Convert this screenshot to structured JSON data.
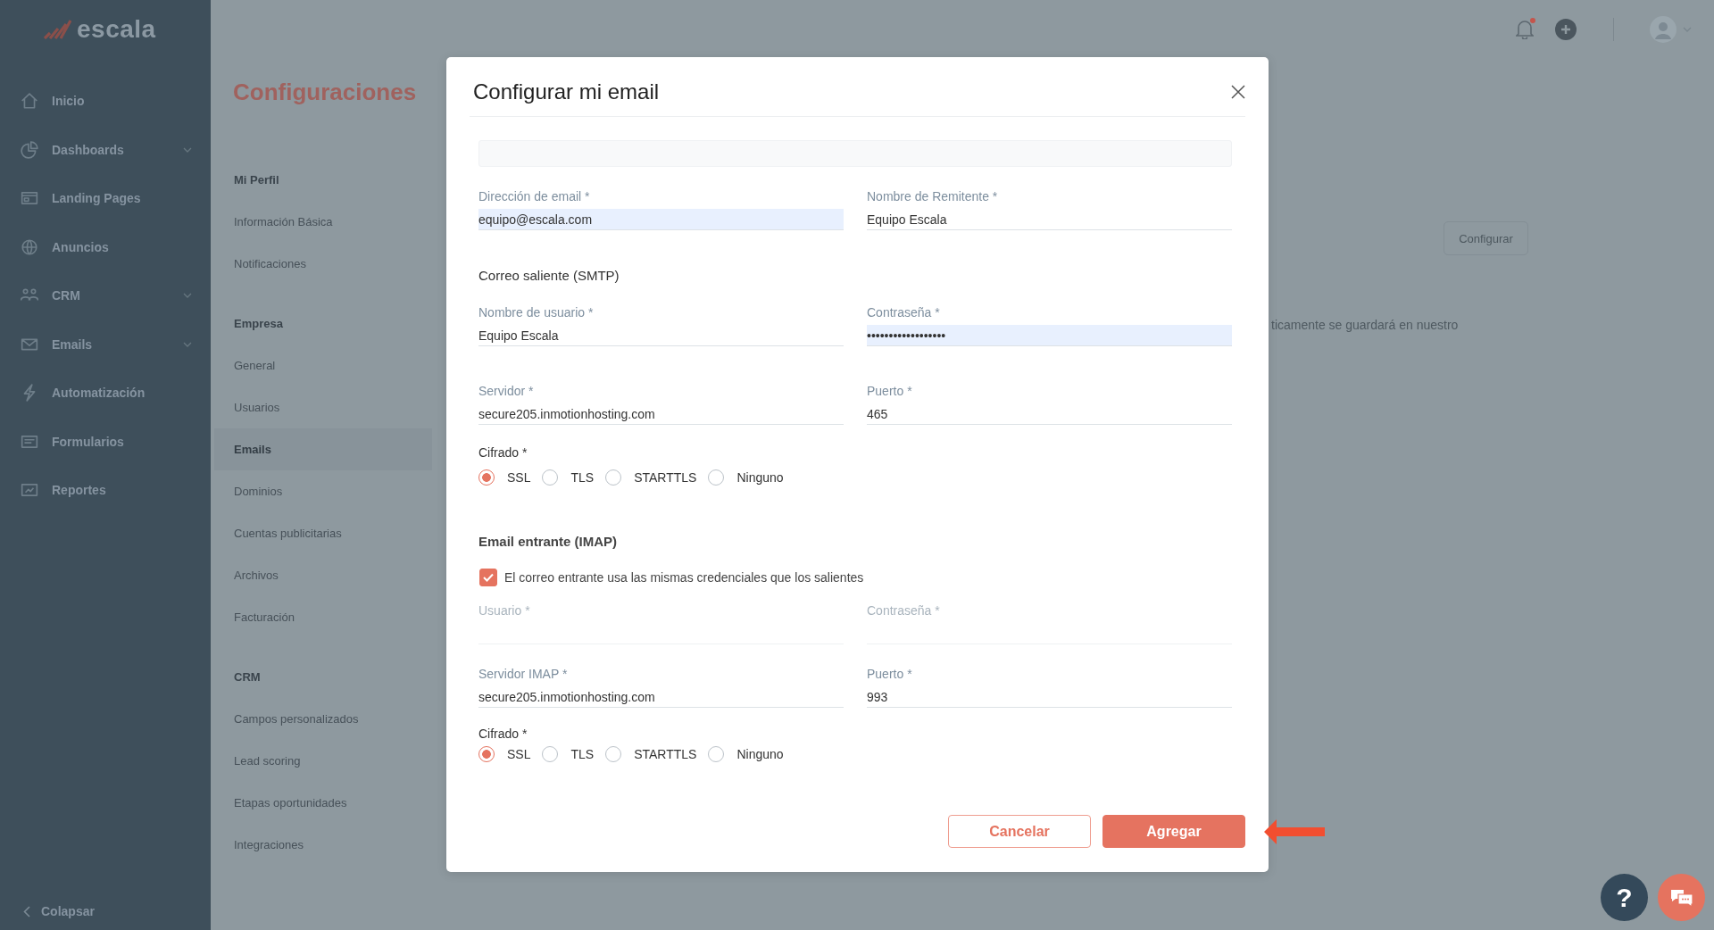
{
  "sidebar": {
    "logo": "escala",
    "items": [
      {
        "label": "Inicio",
        "expandable": false,
        "selected": false
      },
      {
        "label": "Dashboards",
        "expandable": true,
        "selected": false
      },
      {
        "label": "Landing Pages",
        "expandable": false,
        "selected": false
      },
      {
        "label": "Anuncios",
        "expandable": false,
        "selected": false
      },
      {
        "label": "CRM",
        "expandable": true,
        "selected": false
      },
      {
        "label": "Emails",
        "expandable": true,
        "selected": false
      },
      {
        "label": "Automatización",
        "expandable": false,
        "selected": false
      },
      {
        "label": "Formularios",
        "expandable": false,
        "selected": false
      },
      {
        "label": "Reportes",
        "expandable": false,
        "selected": false
      }
    ],
    "collapse": "Colapsar"
  },
  "header": {
    "notifications_unread": true
  },
  "page": {
    "title": "Configuraciones",
    "settings_menu": [
      {
        "heading": "Mi Perfil",
        "items": [
          {
            "label": "Información Básica",
            "selected": false
          },
          {
            "label": "Notificaciones",
            "selected": false
          }
        ]
      },
      {
        "heading": "Empresa",
        "items": [
          {
            "label": "General",
            "selected": false
          },
          {
            "label": "Usuarios",
            "selected": false
          },
          {
            "label": "Emails",
            "selected": true
          },
          {
            "label": "Dominios",
            "selected": false
          },
          {
            "label": "Cuentas publicitarias",
            "selected": false
          },
          {
            "label": "Archivos",
            "selected": false
          },
          {
            "label": "Facturación",
            "selected": false
          }
        ]
      },
      {
        "heading": "CRM",
        "items": [
          {
            "label": "Campos personalizados",
            "selected": false
          },
          {
            "label": "Lead scoring",
            "selected": false
          },
          {
            "label": "Etapas oportunidades",
            "selected": false
          },
          {
            "label": "Integraciones",
            "selected": false
          }
        ]
      }
    ],
    "configure_button": "Configurar",
    "note": "ticamente se guardará en nuestro"
  },
  "dialog": {
    "title": "Configurar mi email",
    "sender": [
      {
        "label": "Dirección de email *",
        "value": "equipo@escala.com",
        "autofilled": true
      },
      {
        "label": "Nombre de Remitente *",
        "value": "Equipo Escala",
        "autofilled": false
      }
    ],
    "smtp": {
      "heading": "Correo saliente (SMTP)",
      "fields": [
        {
          "label": "Nombre de usuario *",
          "value": "Equipo Escala",
          "autofilled": false
        },
        {
          "label": "Contraseña *",
          "value": "••••••••••••••••••",
          "autofilled": true
        },
        {
          "label": "Servidor *",
          "value": "secure205.inmotionhosting.com",
          "autofilled": false
        },
        {
          "label": "Puerto *",
          "value": "465",
          "autofilled": false
        }
      ],
      "encryption": {
        "label": "Cifrado *",
        "options": [
          {
            "label": "SSL",
            "selected": true
          },
          {
            "label": "TLS",
            "selected": false
          },
          {
            "label": "STARTTLS",
            "selected": false
          },
          {
            "label": "Ninguno",
            "selected": false
          }
        ]
      }
    },
    "imap": {
      "heading": "Email entrante (IMAP)",
      "same_credentials": {
        "label": "El correo entrante usa las mismas credenciales que los salientes",
        "checked": true
      },
      "credentials": [
        {
          "label": "Usuario *",
          "disabled": true
        },
        {
          "label": "Contraseña *",
          "disabled": true
        }
      ],
      "fields": [
        {
          "label": "Servidor IMAP *",
          "value": "secure205.inmotionhosting.com",
          "autofilled": false
        },
        {
          "label": "Puerto *",
          "value": "993",
          "autofilled": false
        }
      ],
      "encryption": {
        "label": "Cifrado *",
        "options": [
          {
            "label": "SSL",
            "selected": true
          },
          {
            "label": "TLS",
            "selected": false
          },
          {
            "label": "STARTTLS",
            "selected": false
          },
          {
            "label": "Ninguno",
            "selected": false
          }
        ]
      }
    },
    "buttons": [
      {
        "label": "Cancelar",
        "kind": "outline"
      },
      {
        "label": "Agregar",
        "kind": "primary"
      }
    ]
  },
  "help_button": "?"
}
